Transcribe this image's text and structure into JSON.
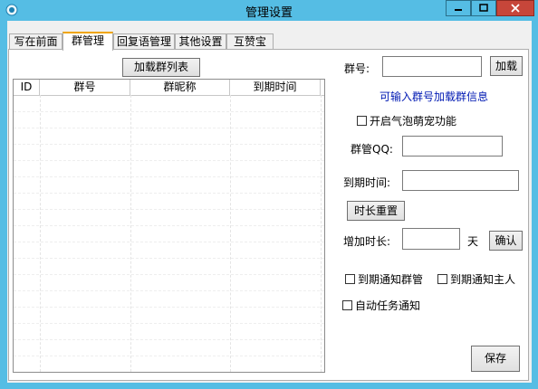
{
  "window": {
    "title": "管理设置"
  },
  "tabs": [
    {
      "label": "写在前面"
    },
    {
      "label": "群管理"
    },
    {
      "label": "回复语管理"
    },
    {
      "label": "其他设置"
    },
    {
      "label": "互赞宝"
    }
  ],
  "active_tab": "群管理",
  "group_panel": {
    "load_list_button": "加载群列表",
    "table": {
      "columns": [
        "ID",
        "群号",
        "群昵称",
        "到期时间"
      ],
      "rows": []
    },
    "group_no_label": "群号:",
    "group_no_value": "",
    "load_button": "加载",
    "hint": "可输入群号加载群信息",
    "enable_bubble": "开启气泡萌宠功能",
    "admin_qq_label": "群管QQ:",
    "admin_qq_value": "",
    "expire_label": "到期时间:",
    "expire_value": "",
    "reset_button": "时长重置",
    "add_duration_label": "增加时长:",
    "add_duration_value": "",
    "unit": "天",
    "confirm_button": "确认",
    "notify_admin": "到期通知群管",
    "notify_owner": "到期通知主人",
    "auto_notify": "自动任务通知",
    "save_button": "保存"
  },
  "colors": {
    "title_bar": "#55bde4",
    "close_button": "#c7463a",
    "active_tab_accent": "#f0a500",
    "hint_text": "#0019b3"
  }
}
